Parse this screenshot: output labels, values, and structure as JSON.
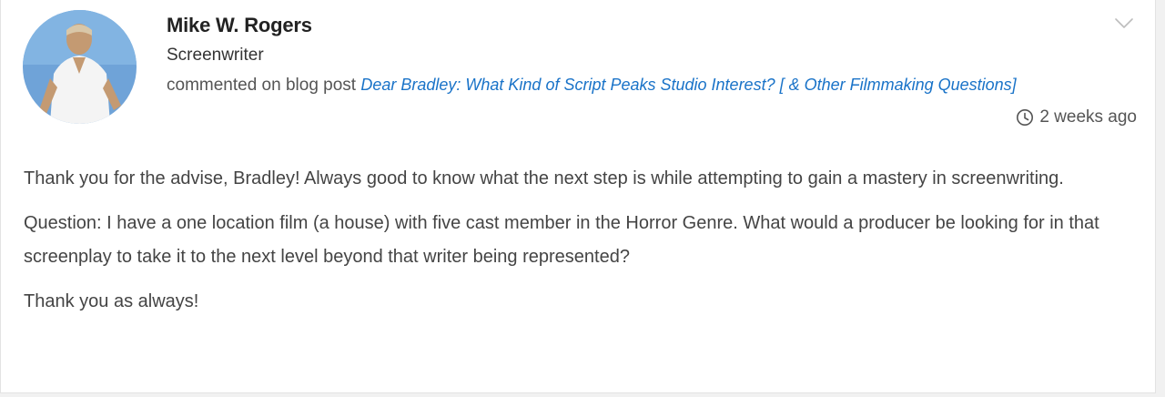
{
  "author": {
    "name": "Mike W. Rogers",
    "role": "Screenwriter"
  },
  "activity": {
    "prefix": "commented on blog post",
    "post_title": "Dear Bradley: What Kind of Script Peaks Studio Interest? [ & Other Filmmaking Questions]"
  },
  "timestamp": "2 weeks ago",
  "icons": {
    "menu": "chevron-down-icon",
    "time": "clock-icon"
  },
  "colors": {
    "link": "#1a73c8",
    "text": "#444444"
  },
  "comment": {
    "paragraphs": [
      "Thank you for the advise, Bradley! Always good to know what the next step is while attempting to gain a mastery in screenwriting.",
      "Question: I have a one location film (a house) with five cast member in the Horror Genre. What would a producer be looking for in that screenplay to take it to the next level beyond that writer being represented?",
      "Thank you as always!"
    ]
  }
}
